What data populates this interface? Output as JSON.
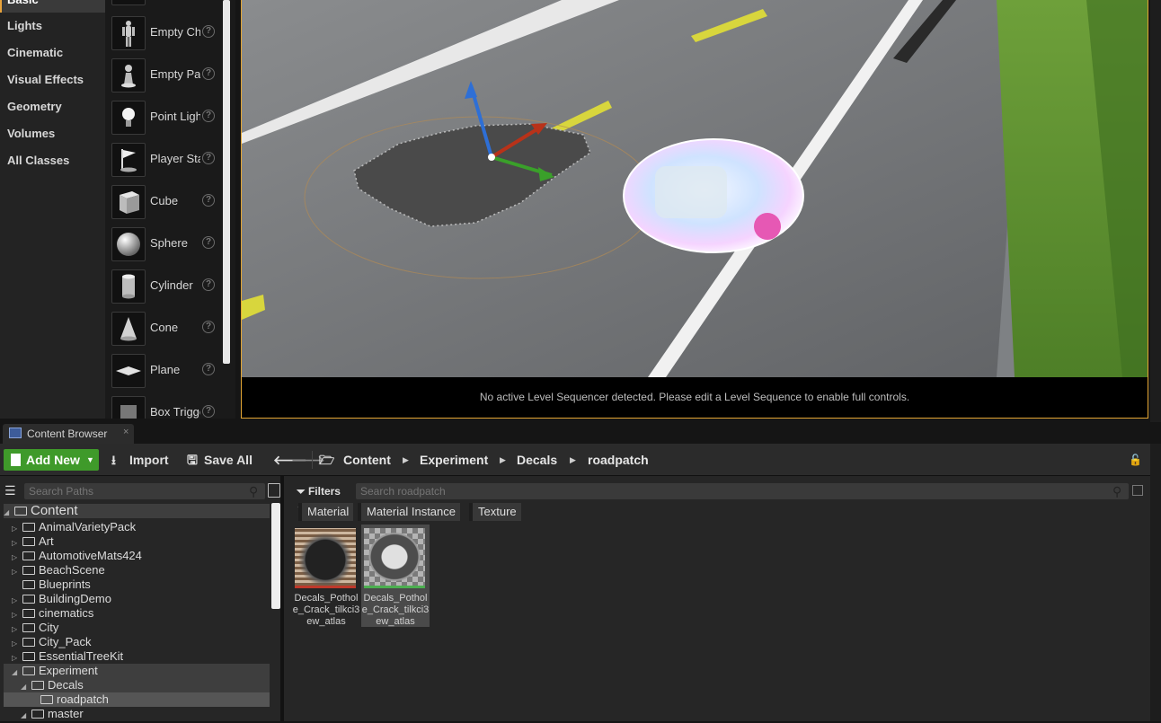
{
  "place_actors": {
    "categories": [
      "Basic",
      "Lights",
      "Cinematic",
      "Visual Effects",
      "Geometry",
      "Volumes",
      "All Classes"
    ],
    "actors": [
      "Empty Character",
      "Empty Pawn",
      "Point Light",
      "Player Start",
      "Cube",
      "Sphere",
      "Cylinder",
      "Cone",
      "Plane",
      "Box Trigger"
    ],
    "help_glyph": "?"
  },
  "viewport": {
    "sequencer_message": "No active Level Sequencer detected. Please edit a Level Sequence to enable full controls."
  },
  "content_browser": {
    "tab_label": "Content Browser",
    "tab_close": "×",
    "toolbar": {
      "add_new": "Add New",
      "import": "Import",
      "save_all": "Save All"
    },
    "breadcrumb": [
      "Content",
      "Experiment",
      "Decals",
      "roadpatch"
    ],
    "path_search_placeholder": "Search Paths",
    "asset_search_placeholder": "Search roadpatch",
    "filters_label": "Filters",
    "filter_chips": [
      "Material",
      "Material Instance",
      "Texture"
    ],
    "tree": {
      "root": "Content",
      "folders": [
        "AnimalVarietyPack",
        "Art",
        "AutomotiveMats424",
        "BeachScene",
        "Blueprints",
        "BuildingDemo",
        "cinematics",
        "City",
        "City_Pack",
        "EssentialTreeKit",
        "Experiment",
        "Decals",
        "roadpatch",
        "master"
      ]
    },
    "assets": [
      {
        "name": "Decals_Pothole_Crack_tilkci3ew_atlas",
        "type_color": "#c0392b"
      },
      {
        "name": "Decals_Pothole_Crack_tilkci3ew_atlas",
        "type_color": "#4caf50"
      }
    ]
  }
}
